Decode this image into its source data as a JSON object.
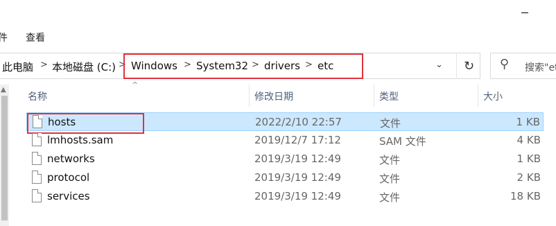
{
  "menu": {
    "partial_left": "件",
    "view": "查看"
  },
  "address_bar": {
    "breadcrumbs": [
      "此电脑",
      "本地磁盘 (C:)",
      "Windows",
      "System32",
      "drivers",
      "etc"
    ],
    "separator": ">",
    "search_placeholder": "搜索\"etc\""
  },
  "columns": {
    "name": "名称",
    "date": "修改日期",
    "type": "类型",
    "size": "大小"
  },
  "files": [
    {
      "name": "hosts",
      "date": "2022/2/10 22:57",
      "type": "文件",
      "size": "1 KB",
      "selected": true
    },
    {
      "name": "lmhosts.sam",
      "date": "2019/12/7 17:12",
      "type": "SAM 文件",
      "size": "4 KB"
    },
    {
      "name": "networks",
      "date": "2019/3/19 12:49",
      "type": "文件",
      "size": "1 KB"
    },
    {
      "name": "protocol",
      "date": "2019/3/19 12:49",
      "type": "文件",
      "size": "2 KB"
    },
    {
      "name": "services",
      "date": "2019/3/19 12:49",
      "type": "文件",
      "size": "18 KB"
    }
  ],
  "colors": {
    "selection_bg": "#cce8ff",
    "selection_border": "#99d1ff",
    "annotation_red": "#e0313b",
    "header_text": "#4c607a"
  }
}
